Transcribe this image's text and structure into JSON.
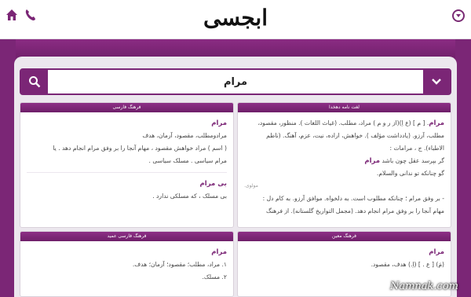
{
  "header": {
    "logo_text": "ابجسی",
    "icons": [
      "home-icon",
      "phone-icon",
      "menu-icon"
    ],
    "accent": "#7b2676"
  },
  "search": {
    "value": "مرام",
    "search_icon": "search-icon",
    "dropdown_icon": "chevron-down-icon"
  },
  "cards": {
    "dehkhoda": {
      "title": "لغت نامه دهخدا",
      "headword": "مرام",
      "line1": ". [ م ] (ع اِ)(از ر و م ) مراد، مطلب. (غیاث اللغات ). منظور، مقصود،",
      "line2": "مطلب، آرزو. (یادداشت مؤلف ). خواهش، اراده، نیت، عزم، آهنگ. (ناظم",
      "line3": "الاطباء). ج ، مرامات :",
      "verse1_a": "گر بپرسد عقل چون باشد",
      "verse1_b": "مرام",
      "verse2": "گو چنانکه تو ندانی والسلام.",
      "poet": "مولوی.",
      "line4": "- بر وفق مرام ؛ چنانکه مطلوب است. به دلخواه. موافق آرزو. به کام دل :",
      "line5": "مهام آنجا را بر وفق مرام انجام دهد. (مجمل التواریخ گلستانه). از فرهنگ"
    },
    "farsi": {
      "title": "فرهنگ فارسی",
      "headword": "مرام",
      "line1": "مرادومطلب، مقصود، آرمان، هدف",
      "line2": "( اسم ) مراد خواهش مقصود ، مهام آنجا را بر وفق مرام انجام دهد . یا",
      "line3": "مرام سیاسی . مسلک سیاسی .",
      "headword2": "بی مرام",
      "line4": "بی مسلک ، که مسلکی ندارد ."
    },
    "moein": {
      "title": "فرهنگ معین",
      "headword": "مرام",
      "line1": "(مَ) [ ع . ] (اِ.) هدف، مقصود."
    },
    "amid": {
      "title": "فرهنگ فارسی عمید",
      "headword": "مرام",
      "line1": "۱. مراد، مطلب؛ مقصود؛ آرمان؛ هدف.",
      "line2": "۲. مسلک."
    }
  },
  "watermark": "Namnak.com"
}
